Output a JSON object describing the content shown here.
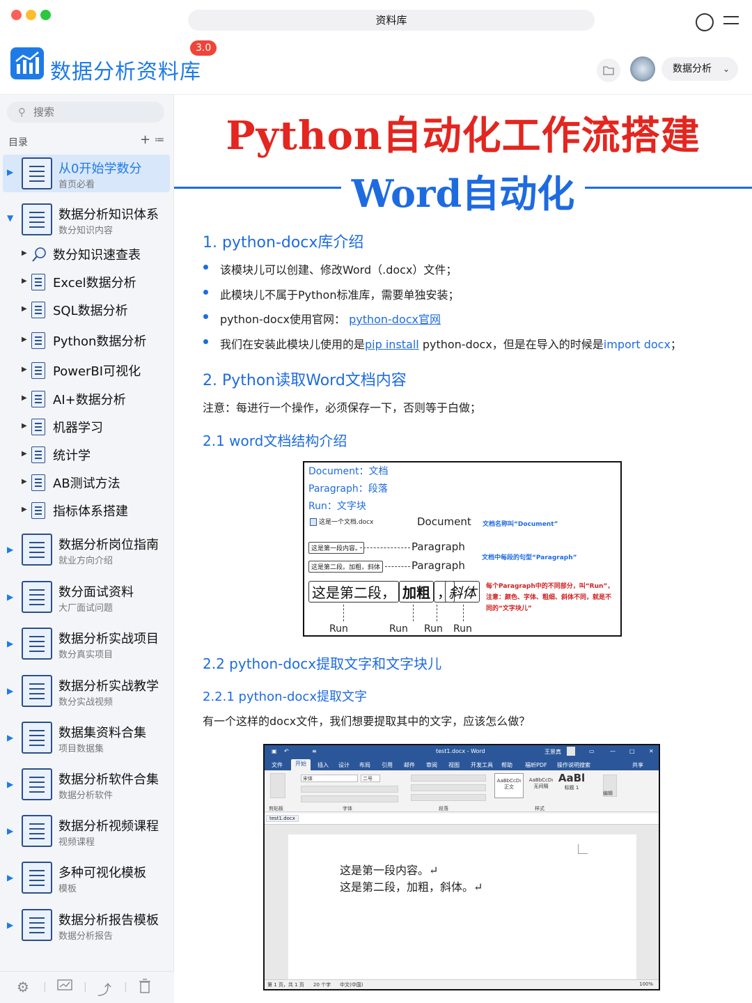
{
  "window": {
    "title": "资料库"
  },
  "header": {
    "app_title": "数据分析资料库",
    "version": "3.0",
    "select_value": "数据分析"
  },
  "sidebar": {
    "search_placeholder": "搜索",
    "toc_label": "目录",
    "add_symbol": "+",
    "list_symbol": "≔",
    "items": [
      {
        "title": "从0开始学数分",
        "subtitle": "首页必看"
      },
      {
        "title": "数据分析知识体系",
        "subtitle": "数分知识内容"
      },
      {
        "title": "数据分析岗位指南",
        "subtitle": "就业方向介绍"
      },
      {
        "title": "数分面试资料",
        "subtitle": "大厂面试问题"
      },
      {
        "title": "数据分析实战项目",
        "subtitle": "数分真实项目"
      },
      {
        "title": "数据分析实战教学",
        "subtitle": "数分实战视频"
      },
      {
        "title": "数据集资料合集",
        "subtitle": "项目数据集"
      },
      {
        "title": "数据分析软件合集",
        "subtitle": "数据分析软件"
      },
      {
        "title": "数据分析视频课程",
        "subtitle": "视频课程"
      },
      {
        "title": "多种可视化模板",
        "subtitle": "模板"
      },
      {
        "title": "数据分析报告模板",
        "subtitle": "数据分析报告"
      }
    ],
    "subitems": [
      "数分知识速查表",
      "Excel数据分析",
      "SQL数据分析",
      "Python数据分析",
      "PowerBI可视化",
      "AI+数据分析",
      "机器学习",
      "统计学",
      "AB测试方法",
      "指标体系搭建"
    ]
  },
  "article": {
    "title": "Python自动化工作流搭建",
    "subtitle": "Word自动化",
    "s1": {
      "heading": "1. python-docx库介绍",
      "b1": "该模块儿可以创建、修改Word（.docx）文件；",
      "b2": "此模块儿不属于Python标准库，需要单独安装；",
      "b3_prefix": "python-docx使用官网：",
      "b3_link": "python-docx官网",
      "b4_a": "我们在安装此模块儿使用的是",
      "b4_b": "pip install",
      "b4_c": " python-docx，但是在导入的时候是",
      "b4_d": "import docx",
      "b4_e": "；"
    },
    "s2": {
      "heading": "2. Python读取Word文档内容",
      "note": "注意：每进行一个操作，必须保存一下，否则等于白做；"
    },
    "s21": {
      "heading": "2.1 word文档结构介绍"
    },
    "diagram": {
      "label_document": "Document：文档",
      "label_paragraph": "Paragraph：段落",
      "label_run": "Run：文字块",
      "file_name": "这是一个文档.docx",
      "word_document": "Document",
      "note_document": "文档名称叫“Document”",
      "box_p1": "这是第一段内容。",
      "box_p2": "这是第二段。加粗，斜体",
      "word_paragraph": "Paragraph",
      "note_paragraph": "文档中每段的句型“Paragraph”",
      "run_1": "这是第二段，",
      "run_2": "加粗",
      "run_3": "，",
      "run_4": "斜体",
      "red_note_1": "每个Paragraph中的不同部分，叫“Run”，",
      "red_note_2": "注意：颜色、字体、粗细、斜体不同，就是不",
      "red_note_3": "同的“文字块儿”",
      "run_label": "Run"
    },
    "s22": {
      "heading": "2.2 python-docx提取文字和文字块儿"
    },
    "s221": {
      "heading": "2.2.1 python-docx提取文字",
      "para": "有一个这样的docx文件，我们想要提取其中的文字，应该怎么做？"
    },
    "word_window": {
      "title": "test1.docx  -  Word",
      "user": "王景真",
      "tabs": [
        "文件",
        "开始",
        "插入",
        "设计",
        "布局",
        "引用",
        "邮件",
        "审阅",
        "视图",
        "开发工具",
        "帮助",
        "福昕PDF",
        "操作说明搜索"
      ],
      "share": "共享",
      "font_name": "宋体",
      "font_size": "二号",
      "groups": [
        "剪贴板",
        "字体",
        "段落",
        "样式",
        "编辑"
      ],
      "styles": [
        "AaBbCcDı",
        "AaBbCcDı",
        "AaBl"
      ],
      "style_names": [
        "正文",
        "无间隔",
        "标题 1"
      ],
      "doc_tab": "test1.docx",
      "line1": "这是第一段内容。↵",
      "line2": "这是第二段，加粗，斜体。↵",
      "status_page": "第 1 页，共 1 页",
      "status_words": "20 个字",
      "status_lang": "中文(中国)",
      "status_zoom": "100%"
    }
  }
}
